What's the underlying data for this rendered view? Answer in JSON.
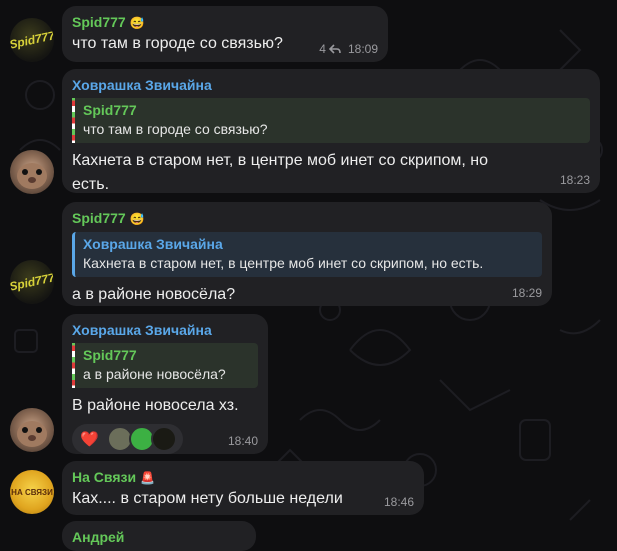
{
  "messages": [
    {
      "sender": "Spid777",
      "sender_emoji": "😅",
      "text": "что там в городе со связью?",
      "reply_count": "4",
      "time": "18:09"
    },
    {
      "sender": "Ховрашка Звичайна",
      "quote": {
        "name": "Spid777",
        "text": "что там в городе со связью?"
      },
      "text_line1": "Кахнета в старом нет, в центре моб инет со скрипом, но",
      "text_line2": "есть.",
      "time": "18:23"
    },
    {
      "sender": "Spid777",
      "sender_emoji": "😅",
      "quote": {
        "name": "Ховрашка Звичайна",
        "text": "Кахнета в старом нет, в центре моб инет со скрипом, но есть."
      },
      "text": "а в районе новосёла?",
      "time": "18:29"
    },
    {
      "sender": "Ховрашка Звичайна",
      "quote": {
        "name": "Spid777",
        "text": "а в районе новосёла?"
      },
      "text": "В районе новосела хз.",
      "reaction": "❤️",
      "time": "18:40"
    },
    {
      "sender": "На Связи",
      "sender_emoji": "🚨",
      "text": "Ках.... в старом нету больше недели",
      "time": "18:46"
    },
    {
      "sender": "Андрей"
    }
  ],
  "avatars": {
    "spid_label": "Spid777",
    "nasv_label_1": "НА СВЯЗИ"
  },
  "colors": {
    "background": "#0e0e10",
    "bubble": "#212124",
    "green_name": "#64c859",
    "blue_name": "#5aa7e8",
    "time": "#9a9a9e"
  },
  "icons": [
    "reply-arrow-icon",
    "heart-reaction-icon"
  ]
}
